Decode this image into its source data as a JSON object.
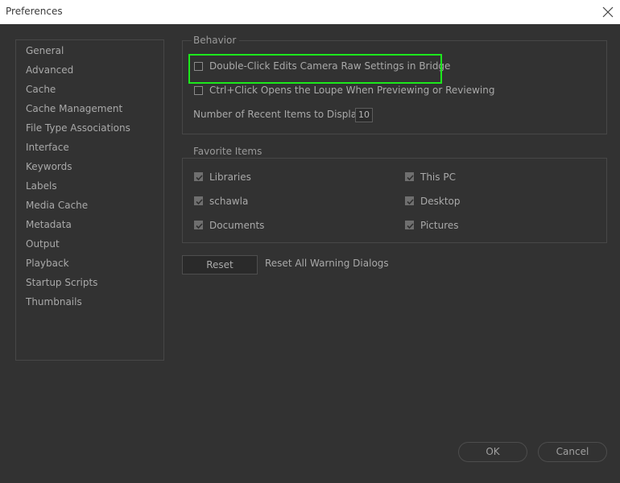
{
  "window": {
    "title": "Preferences"
  },
  "sidebar": {
    "items": [
      {
        "label": "General"
      },
      {
        "label": "Advanced"
      },
      {
        "label": "Cache"
      },
      {
        "label": "Cache Management"
      },
      {
        "label": "File Type Associations"
      },
      {
        "label": "Interface"
      },
      {
        "label": "Keywords"
      },
      {
        "label": "Labels"
      },
      {
        "label": "Media Cache"
      },
      {
        "label": "Metadata"
      },
      {
        "label": "Output"
      },
      {
        "label": "Playback"
      },
      {
        "label": "Startup Scripts"
      },
      {
        "label": "Thumbnails"
      }
    ]
  },
  "behavior": {
    "legend": "Behavior",
    "double_click_label": "Double-Click Edits Camera Raw Settings in Bridge",
    "double_click_checked": false,
    "ctrl_click_label": "Ctrl+Click Opens the Loupe When Previewing or Reviewing",
    "ctrl_click_checked": false,
    "recent_items_label": "Number of Recent Items to Display",
    "recent_items_value": "10"
  },
  "favorites": {
    "legend": "Favorite Items",
    "items": [
      {
        "label": "Libraries",
        "checked": true
      },
      {
        "label": "This PC",
        "checked": true
      },
      {
        "label": "schawla",
        "checked": true
      },
      {
        "label": "Desktop",
        "checked": true
      },
      {
        "label": "Documents",
        "checked": true
      },
      {
        "label": "Pictures",
        "checked": true
      }
    ]
  },
  "reset": {
    "button_label": "Reset",
    "description": "Reset All Warning Dialogs"
  },
  "footer": {
    "ok_label": "OK",
    "cancel_label": "Cancel"
  },
  "colors": {
    "background": "#323232",
    "highlight": "#1ce81c"
  }
}
